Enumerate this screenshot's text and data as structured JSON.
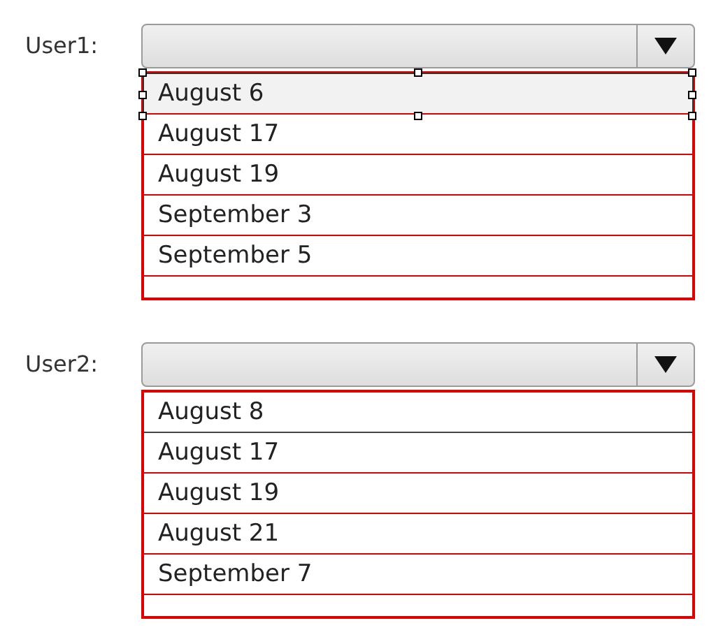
{
  "users": [
    {
      "label": "User1:",
      "options": [
        {
          "text": "August 6",
          "selected": true,
          "highlighted": true
        },
        {
          "text": "August 17",
          "selected": false,
          "highlighted": true
        },
        {
          "text": "August 19",
          "selected": false,
          "highlighted": true
        },
        {
          "text": "September 3",
          "selected": false,
          "highlighted": true
        },
        {
          "text": "September 5",
          "selected": false,
          "highlighted": true
        }
      ]
    },
    {
      "label": "User2:",
      "options": [
        {
          "text": "August 8",
          "selected": false,
          "highlighted": false
        },
        {
          "text": "August 17",
          "selected": false,
          "highlighted": true
        },
        {
          "text": "August 19",
          "selected": false,
          "highlighted": true
        },
        {
          "text": "August 21",
          "selected": false,
          "highlighted": true
        },
        {
          "text": "September 7",
          "selected": false,
          "highlighted": true
        }
      ]
    }
  ]
}
